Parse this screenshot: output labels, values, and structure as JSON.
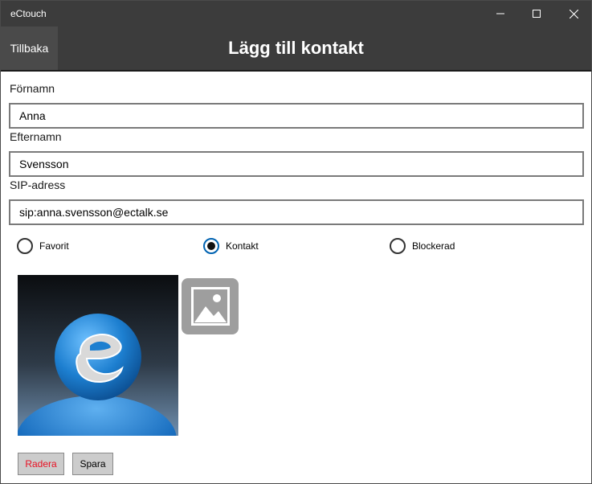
{
  "window": {
    "title": "eCtouch"
  },
  "header": {
    "back_label": "Tillbaka",
    "title": "Lägg till kontakt"
  },
  "form": {
    "first_name": {
      "label": "Förnamn",
      "value": "Anna"
    },
    "last_name": {
      "label": "Efternamn",
      "value": "Svensson"
    },
    "sip": {
      "label": "SIP-adress",
      "value": "sip:anna.svensson@ectalk.se"
    }
  },
  "category": {
    "options": [
      {
        "label": "Favorit",
        "checked": false
      },
      {
        "label": "Kontakt",
        "checked": true
      },
      {
        "label": "Blockerad",
        "checked": false
      }
    ]
  },
  "image": {
    "picker_icon": "image-icon"
  },
  "actions": {
    "delete_label": "Radera",
    "save_label": "Spara"
  },
  "colors": {
    "titlebar": "#3c3c3c",
    "accent": "#0063b1",
    "delete_text": "#e81123"
  }
}
